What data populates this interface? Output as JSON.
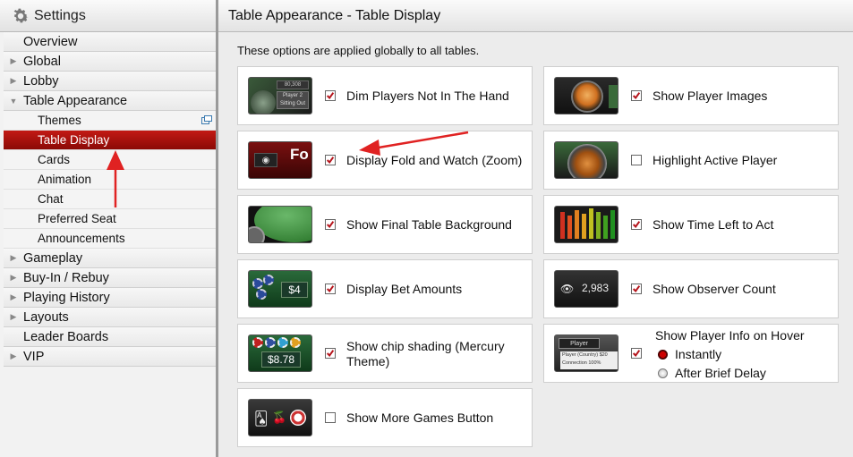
{
  "sidebar": {
    "title": "Settings",
    "items": [
      {
        "label": "Overview",
        "type": "nochild"
      },
      {
        "label": "Global",
        "type": "collapsed"
      },
      {
        "label": "Lobby",
        "type": "collapsed"
      },
      {
        "label": "Table Appearance",
        "type": "expanded"
      },
      {
        "label": "Themes",
        "type": "sub"
      },
      {
        "label": "Table Display",
        "type": "sub-active"
      },
      {
        "label": "Cards",
        "type": "sub"
      },
      {
        "label": "Animation",
        "type": "sub"
      },
      {
        "label": "Chat",
        "type": "sub"
      },
      {
        "label": "Preferred Seat",
        "type": "sub"
      },
      {
        "label": "Announcements",
        "type": "sub"
      },
      {
        "label": "Gameplay",
        "type": "collapsed"
      },
      {
        "label": "Buy-In / Rebuy",
        "type": "collapsed"
      },
      {
        "label": "Playing History",
        "type": "collapsed"
      },
      {
        "label": "Layouts",
        "type": "collapsed"
      },
      {
        "label": "Leader Boards",
        "type": "nochild"
      },
      {
        "label": "VIP",
        "type": "collapsed"
      }
    ]
  },
  "main": {
    "title": "Table Appearance - Table Display",
    "intro": "These options are applied globally to all tables.",
    "options": [
      {
        "label": "Dim Players Not In The Hand",
        "checked": true,
        "icon": "dim-players-thumbnail",
        "thumb_text": [
          "80,308",
          "Player 2",
          "Sitting Out"
        ]
      },
      {
        "label": "Show Player Images",
        "checked": true,
        "icon": "tiger-avatar-thumbnail"
      },
      {
        "label": "Display Fold and Watch (Zoom)",
        "checked": true,
        "icon": "fold-watch-thumbnail",
        "thumb_text": "Fo"
      },
      {
        "label": "Highlight Active Player",
        "checked": false,
        "icon": "active-player-thumbnail"
      },
      {
        "label": "Show Final Table Background",
        "checked": true,
        "icon": "green-table-thumbnail"
      },
      {
        "label": "Show Time Left to Act",
        "checked": true,
        "icon": "time-bars-thumbnail"
      },
      {
        "label": "Display Bet Amounts",
        "checked": true,
        "icon": "bet-chips-thumbnail",
        "thumb_text": "$4"
      },
      {
        "label": "Show Observer Count",
        "checked": true,
        "icon": "observer-eye-thumbnail",
        "thumb_text": "2,983"
      },
      {
        "label": "Show chip shading (Mercury Theme)",
        "checked": true,
        "icon": "chip-shading-thumbnail",
        "thumb_text": "$8.78"
      },
      {
        "label": "Show Player Info on Hover",
        "checked": true,
        "icon": "player-info-thumbnail",
        "thumb_text": [
          "Player",
          "Player (Country) $20",
          "Connection 100%"
        ]
      },
      {
        "label": "Show More Games Button",
        "checked": false,
        "icon": "more-games-thumbnail"
      }
    ],
    "hover_options": {
      "instantly": "Instantly",
      "after_delay": "After Brief Delay",
      "selected": "Instantly"
    }
  },
  "colors": {
    "active_nav": "#b0120d",
    "checkmark": "#b5151c",
    "annotation_arrow": "#e02222"
  }
}
